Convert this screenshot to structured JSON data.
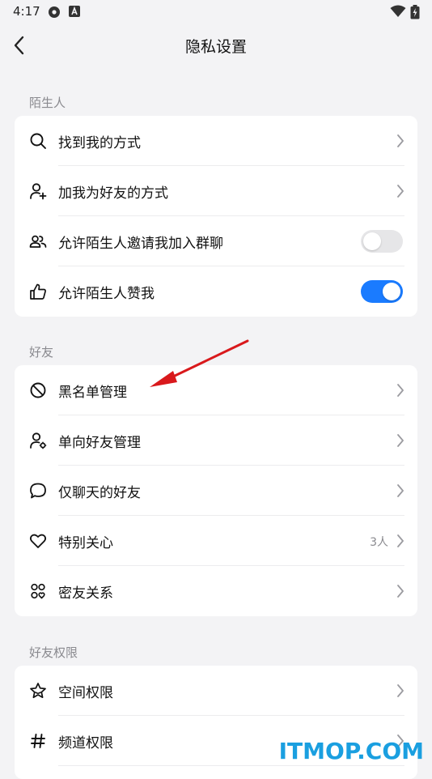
{
  "status_bar": {
    "time": "4:17",
    "icons": [
      "gear-icon",
      "a-badge-icon",
      "wifi-icon",
      "battery-icon"
    ]
  },
  "nav": {
    "back_icon": "back-chevron-icon",
    "title": "隐私设置"
  },
  "sections": {
    "strangers": {
      "label": "陌生人",
      "items": [
        {
          "label": "找到我的方式",
          "icon": "search-icon"
        },
        {
          "label": "加我为好友的方式",
          "icon": "person-add-icon"
        },
        {
          "label": "允许陌生人邀请我加入群聊",
          "icon": "group-icon",
          "toggle": false
        },
        {
          "label": "允许陌生人赞我",
          "icon": "thumbs-up-icon",
          "toggle": true
        }
      ]
    },
    "friends": {
      "label": "好友",
      "items": [
        {
          "label": "黑名单管理",
          "icon": "block-icon"
        },
        {
          "label": "单向好友管理",
          "icon": "person-gear-icon"
        },
        {
          "label": "仅聊天的好友",
          "icon": "chat-bubble-icon"
        },
        {
          "label": "特别关心",
          "icon": "heart-icon",
          "value": "3人"
        },
        {
          "label": "密友关系",
          "icon": "close-friends-icon"
        }
      ]
    },
    "permissions": {
      "label": "好友权限",
      "items": [
        {
          "label": "空间权限",
          "icon": "star-icon"
        },
        {
          "label": "频道权限",
          "icon": "hash-icon"
        }
      ]
    }
  },
  "colors": {
    "accent": "#1a7bff",
    "annotation_arrow": "#d9191c",
    "watermark": "#1a9fe0"
  },
  "watermark": "ITMOP.COM"
}
